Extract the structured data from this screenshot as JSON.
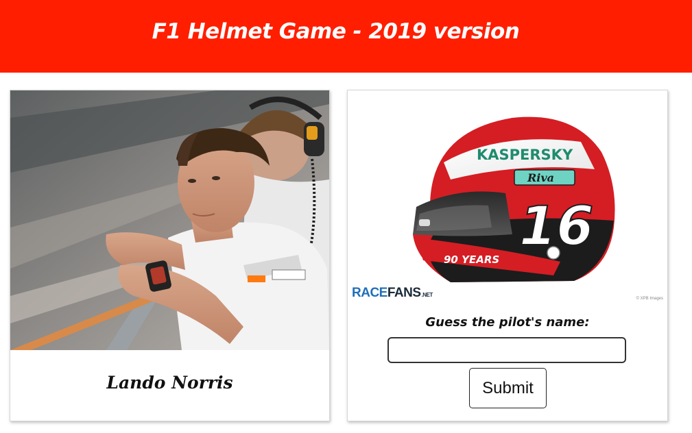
{
  "header": {
    "title": "F1 Helmet Game - 2019 version",
    "background": "#ff1e00"
  },
  "driver_card": {
    "photo_alt": "Lando Norris",
    "name": "Lando Norris"
  },
  "helmet_card": {
    "helmet_alt": "Helmet #16",
    "brand_text": "KASPERSKY",
    "script_text": "Riva",
    "number_text": "16",
    "years_text": "90 YEARS",
    "watermark": {
      "racefans_prefix": "RACE",
      "racefans_main": "FANS",
      "racefans_suffix": ".NET"
    },
    "credit": "© XPB Images",
    "guess_label": "Guess the pilot's name:",
    "guess_input": {
      "value": "",
      "placeholder": ""
    },
    "submit_label": "Submit"
  }
}
